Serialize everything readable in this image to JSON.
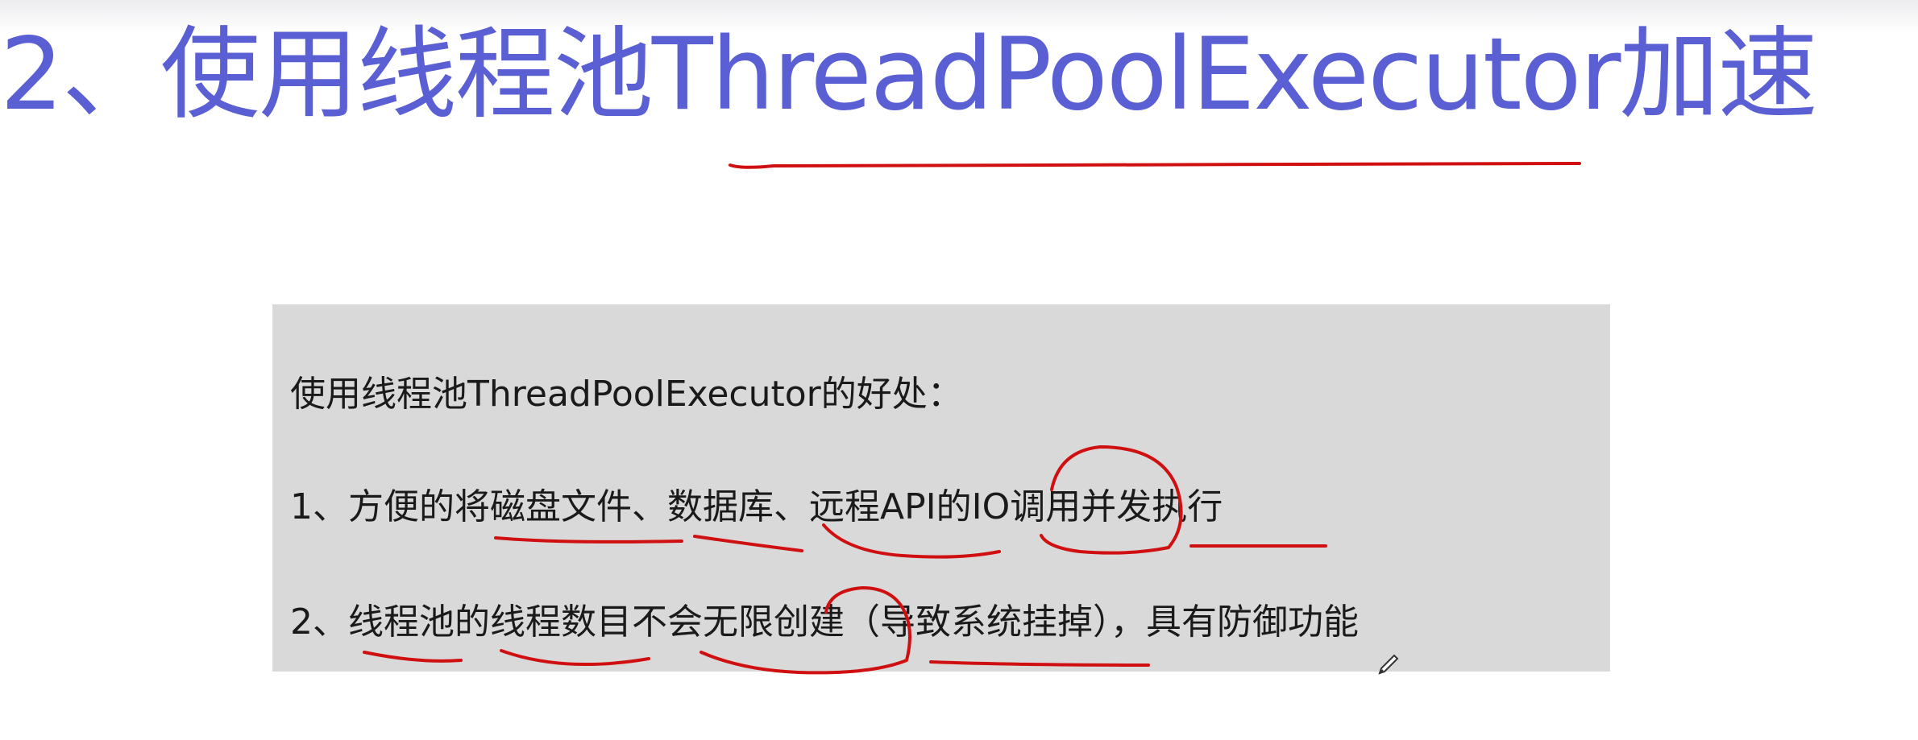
{
  "slide": {
    "title": "2、使用线程池ThreadPoolExecutor加速"
  },
  "content": {
    "intro": "使用线程池ThreadPoolExecutor的好处：",
    "points": [
      "1、方便的将磁盘文件、数据库、远程API的IO调用并发执行",
      "2、线程池的线程数目不会无限创建（导致系统挂掉），具有防御功能"
    ]
  },
  "annotation": {
    "color": "#d01010"
  },
  "icons": {
    "cursor": "pen-cursor-icon"
  }
}
